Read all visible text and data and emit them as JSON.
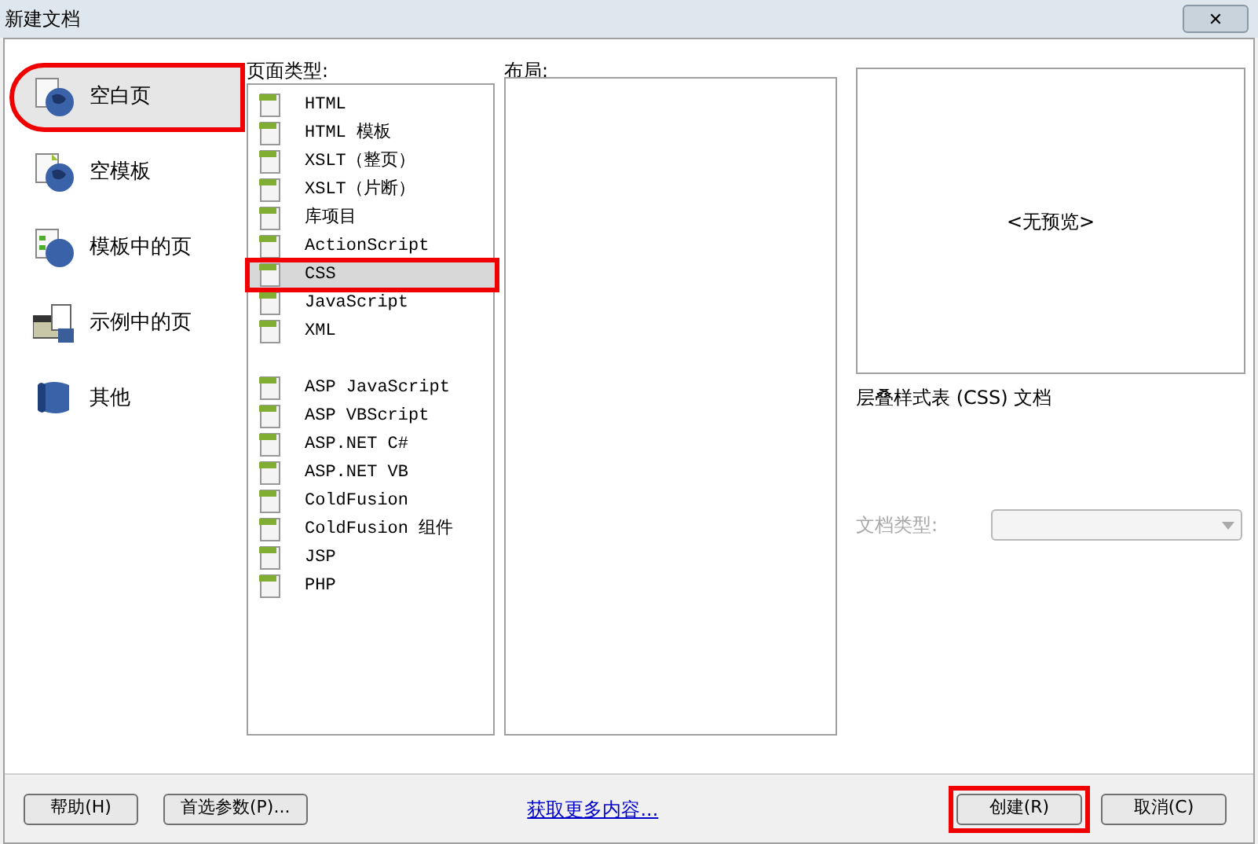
{
  "window": {
    "title": "新建文档",
    "close": "✕"
  },
  "categories": [
    {
      "label": "空白页",
      "selected": true,
      "kind": "blank"
    },
    {
      "label": "空模板",
      "selected": false,
      "kind": "template"
    },
    {
      "label": "模板中的页",
      "selected": false,
      "kind": "page"
    },
    {
      "label": "示例中的页",
      "selected": false,
      "kind": "sample"
    },
    {
      "label": "其他",
      "selected": false,
      "kind": "other"
    }
  ],
  "page_types": {
    "label": "页面类型:",
    "groups": [
      [
        {
          "label": "HTML",
          "selected": false
        },
        {
          "label": "HTML 模板",
          "selected": false
        },
        {
          "label": "XSLT（整页）",
          "selected": false
        },
        {
          "label": "XSLT（片断）",
          "selected": false
        },
        {
          "label": "库项目",
          "selected": false
        },
        {
          "label": "ActionScript",
          "selected": false
        },
        {
          "label": "CSS",
          "selected": true
        },
        {
          "label": "JavaScript",
          "selected": false
        },
        {
          "label": "XML",
          "selected": false
        }
      ],
      [
        {
          "label": "ASP JavaScript",
          "selected": false
        },
        {
          "label": "ASP VBScript",
          "selected": false
        },
        {
          "label": "ASP.NET C#",
          "selected": false
        },
        {
          "label": "ASP.NET VB",
          "selected": false
        },
        {
          "label": "ColdFusion",
          "selected": false
        },
        {
          "label": "ColdFusion 组件",
          "selected": false
        },
        {
          "label": "JSP",
          "selected": false
        },
        {
          "label": "PHP",
          "selected": false
        }
      ]
    ]
  },
  "layout": {
    "label": "布局:"
  },
  "preview": {
    "text": "<无预览>",
    "description": "层叠样式表 (CSS) 文档"
  },
  "doc_type": {
    "label": "文档类型:",
    "disabled": true
  },
  "buttons_left": [
    {
      "label": "帮助(H)"
    },
    {
      "label": "首选参数(P)..."
    }
  ],
  "link": "获取更多内容...",
  "buttons_right": [
    {
      "label": "创建(R)",
      "highlighted": true
    },
    {
      "label": "取消(C)",
      "highlighted": false
    }
  ]
}
